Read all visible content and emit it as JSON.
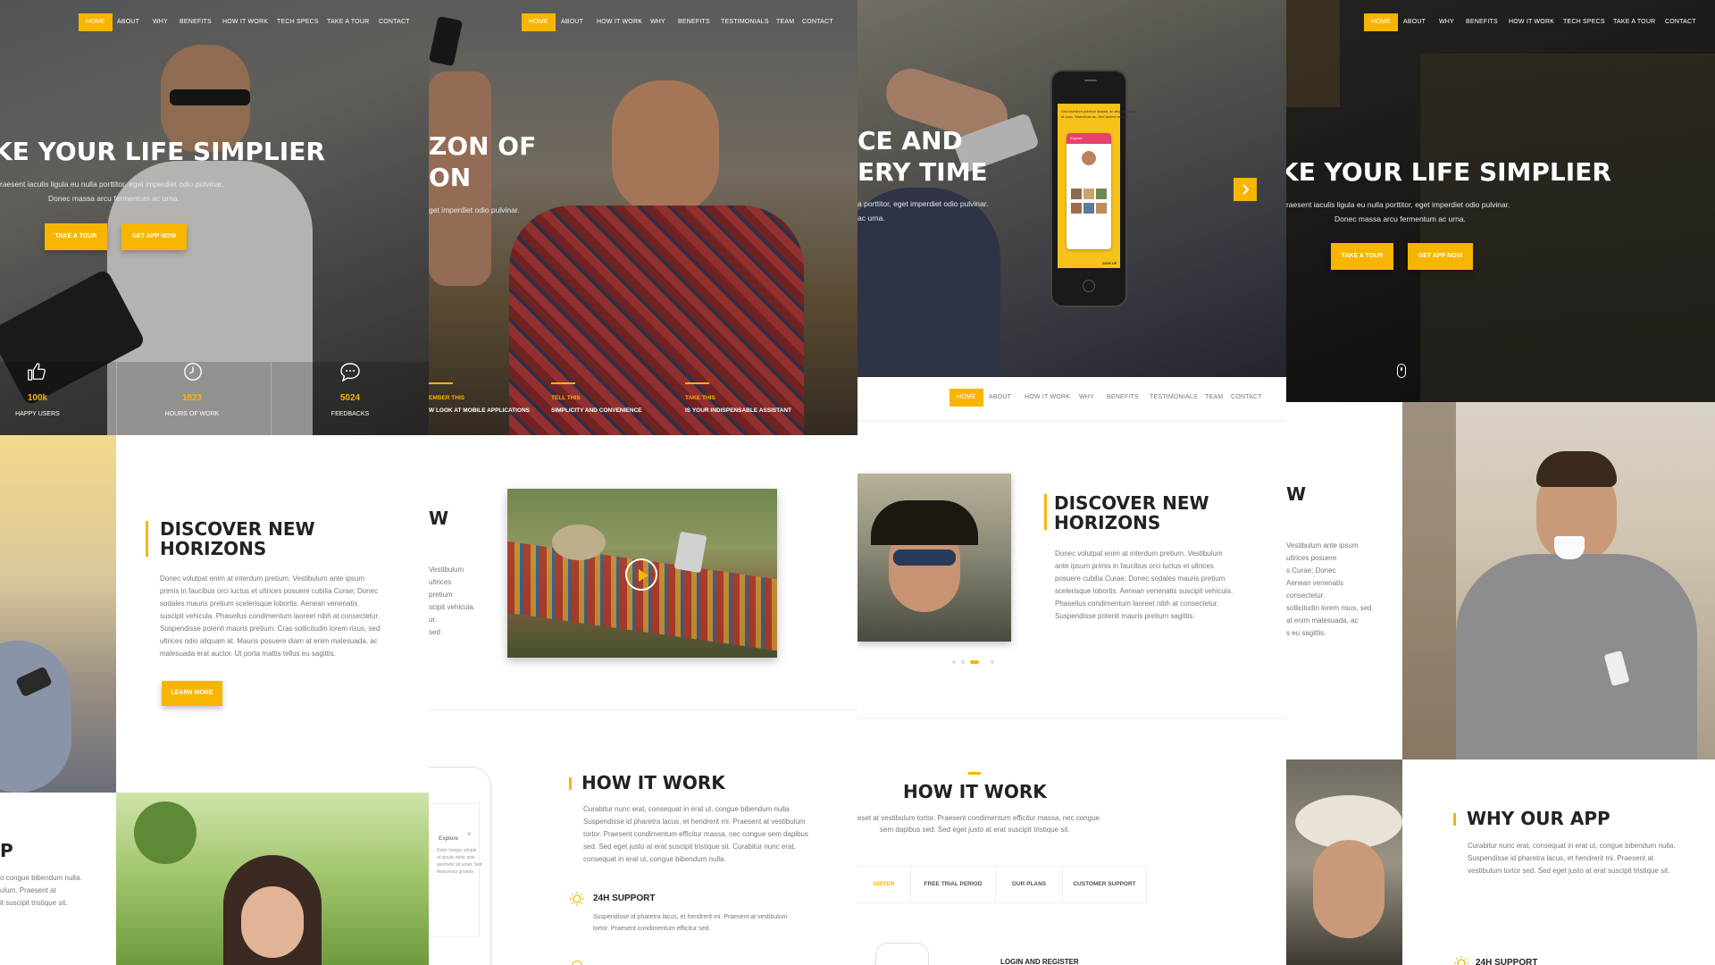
{
  "brand": {
    "accent": "#f7b500",
    "dark_text": "#222222",
    "muted_text": "#777777"
  },
  "nav_a": [
    "HOME",
    "ABOUT",
    "WHY",
    "BENEFITS",
    "HOW IT WORK",
    "TECH SPECS",
    "TAKE A TOUR",
    "CONTACT"
  ],
  "nav_b": [
    "HOME",
    "ABOUT",
    "HOW IT WORK",
    "WHY",
    "BENEFITS",
    "TESTIMONIALS",
    "TEAM",
    "CONTACT"
  ],
  "nav_c": [
    "HOME",
    "ABOUT",
    "HOW IT WORK",
    "WHY",
    "BENEFITS",
    "TESTIMONIALS",
    "TEAM",
    "CONTACT"
  ],
  "nav_d": [
    "HOME",
    "ABOUT",
    "WHY",
    "BENEFITS",
    "HOW IT WORK",
    "TECH SPECS",
    "TAKE A TOUR",
    "CONTACT"
  ],
  "col1": {
    "headline": "KE YOUR LIFE SIMPLIER",
    "sub_1": "raesent iaculis ligula eu nulla porttitor, eget imperdiet odio pulvinar.",
    "sub_2": "Donec massa arcu fermentum ac urna.",
    "btn_tour": "TAKE A TOUR",
    "btn_app": "GET APP NOW",
    "stats": [
      {
        "icon": "thumbs-up-icon",
        "value": "100k",
        "label": "HAPPY USERS"
      },
      {
        "icon": "clock-icon",
        "value": "1823",
        "label": "HOURS OF WORK"
      },
      {
        "icon": "chat-bubble-icon",
        "value": "5024",
        "label": "FEEDBACKS"
      }
    ],
    "section_title_1": "DISCOVER NEW",
    "section_title_2": "HORIZONS",
    "para": [
      "Donec volutpat enim at interdum pretium. Vestibulum ante ipsum",
      "primis in faucibus orci luctus et ultrices posuere cubilia Curae; Donec",
      "sodales mauris pretium scelerisque lobortis. Aenean venenatis",
      "suscipit vehicula. Phasellus condimentum laoreet nibh at consectetur.",
      "Suspendisse potenti mauris pretium. Cras sollicitudin lorem risus, sed",
      "ultrices odio aliquam at. Mauris posuere diam at enim malesuada, ac",
      "malesuada erat auctor. Ut porta mattis tellus eu sagittis."
    ],
    "learn_more": "LEARN MORE",
    "bottom_title": "P",
    "bottom_para": [
      "o congue bibendum nulla.",
      "ulum. Praesent at",
      "it suscipit tristique sit."
    ]
  },
  "col2": {
    "headline_1": "ZON OF",
    "headline_2": "ON",
    "sub_1": "get imperdiet odio pulvinar.",
    "features": [
      {
        "title": "EMBER THIS",
        "text": "W LOOK AT MOBILE APPLICATIONS"
      },
      {
        "title": "TELL THIS",
        "text": "SIMPLICITY AND CONVENIENCE"
      },
      {
        "title": "TAKE THIS",
        "text": "IS YOUR INDISPENSABLE ASSISTANT"
      }
    ],
    "section_title_partial": "W",
    "para_partial": [
      "Vestibulum",
      "ultrices",
      "pretium",
      "scipit vehicula.",
      "ur.",
      "sed"
    ],
    "how_title": "HOW IT WORK",
    "how_para": [
      "Curabitur nunc erat, consequat in erat ut, congue bibendum nulla.",
      "Suspendisse id pharetra lacus, et hendrerit mi. Praesent at vestibulum",
      "tortor. Praesent condimentum efficitur massa, nec congue sem dapibus",
      "sed. Sed eget justo at erat suscipit tristique sit. Curabitur nunc erat,",
      "consequat in erat ut, congue bibendum nulla."
    ],
    "support_title": "24H SUPPORT",
    "support_para": [
      "Suspendisse id pharetra lacus, et hendrerit mi. Praesent at vestibulum",
      "tortor. Praesent condimentum efficitur sed."
    ],
    "phone_label": "Explore",
    "phone_para": [
      "Dolor integer simple",
      "et iaculis dolor ante",
      "aesthetic sit amet. Sed",
      "Maecenas gravida"
    ]
  },
  "col3": {
    "headline_1": "CE AND",
    "headline_2": "ERY TIME",
    "sub_1": "a porttitor, eget imperdiet odio pulvinar.",
    "sub_2": "ac urna.",
    "phone_screen_text": [
      "Sed interdum pulvinar massa, ac aliquam lacus",
      "at nunc. Maecenas ac. Sed laoreet lectus."
    ],
    "phone_card_title": "Explore",
    "phone_sign_up": "SIGN UP",
    "section_title_1": "DISCOVER NEW",
    "section_title_2": "HORIZONS",
    "para": [
      "Donec volutpat enim at interdum pretium. Vestibulum",
      "ante ipsum primis in faucibus orci luctus et ultrices",
      "posuere cubilia Curae; Donec sodales mauris pretium",
      "scelerisque lobortis. Aenean venenatis suscipit vehicula.",
      "Phasellus condimentum laoreet nibh at consectetur.",
      "Suspendisse potenti mauris pretium sagittis."
    ],
    "how_title": "HOW IT WORK",
    "how_para": [
      "eset at vestibulum tortor. Praesent condimentum efficitur massa, nec congue",
      "sem dapibus sed. Sed eget justo at erat suscipit tristique sit."
    ],
    "tabs": [
      "GISTER",
      "FREE TRIAL PERIOD",
      "OUR PLANS",
      "CUSTOMER SUPPORT"
    ],
    "login_label": "LOGIN AND REGISTER"
  },
  "col4": {
    "headline": "KE YOUR LIFE SIMPLIER",
    "sub_1": "raesent iaculis ligula eu nulla porttitor, eget imperdiet odio pulvinar.",
    "sub_2": "Donec massa arcu fermentum ac urna.",
    "btn_tour": "TAKE A TOUR",
    "btn_app": "GET APP NOW",
    "section_title_partial": "W",
    "para_partial": [
      "Vestibulum ante ipsum",
      "ultrices posuere",
      "s Curae; Donec",
      "Aenean venenatis",
      "consectetur.",
      "sollicitudin lorem risus, sed",
      "at enim malesuada, ac",
      "s eu sagittis."
    ],
    "why_title": "WHY OUR APP",
    "why_para": [
      "Curabitur nunc erat, consequat in erat ut, congue bibendum nulla.",
      "Suspendisse id pharetra lacus, et hendrerit mi. Praesent at",
      "vestibulum tortor sed. Sed eget justo at erat suscipit tristique sit."
    ],
    "support_title": "24H SUPPORT"
  }
}
